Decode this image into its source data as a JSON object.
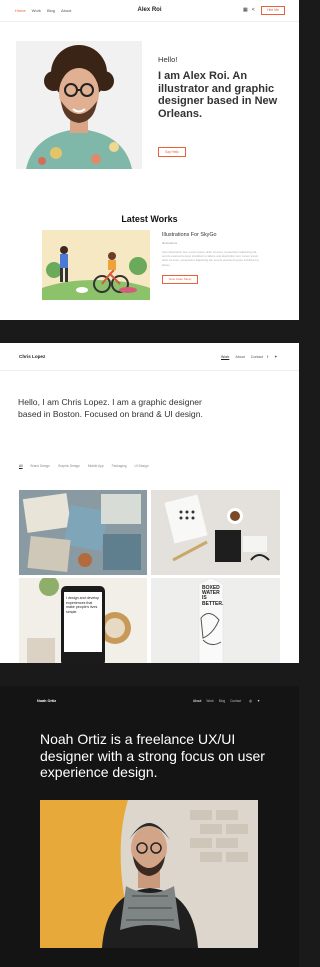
{
  "page1": {
    "nav": {
      "links": [
        "Home",
        "Work",
        "Blog",
        "About"
      ],
      "brand": "Alex Roi",
      "hire_label": "Hire Me"
    },
    "hero": {
      "greeting": "Hello!",
      "intro": "I am Alex Roi. An illustrator and graphic designer based in New Orleans.",
      "button_label": "Say Hello"
    },
    "works": {
      "section_title": "Latest Works",
      "item": {
        "title": "Illustrations For SkyGo",
        "category": "Illustrations",
        "description": "Vero description text. Lorem ipsum dolor sit amet, consectetur adipiscing elit, sed do eiusmod tempor incididunt ut labore and description text. Lorem ipsum dolor sit amet, consectetur adipiscing elit, sed do eiusmod tempor incididunt ut labore.",
        "button_label": "View Case Study"
      }
    }
  },
  "page2": {
    "nav": {
      "brand": "Chris Lopez",
      "menu": [
        "Work",
        "About",
        "Contact"
      ]
    },
    "intro": "Hello, I am Chris Lopez. I am a graphic designer based in Boston. Focused on brand & UI design.",
    "filters": [
      "All",
      "Brand Design",
      "Graphic Design",
      "Mobile App",
      "Packaging",
      "UI Design"
    ],
    "phone_text": "I design and develop experiences that make people's lives simple.",
    "carton_text": "BOXED WATER IS BETTER."
  },
  "page3": {
    "nav": {
      "brand": "Noah Ortiz",
      "menu": [
        "About",
        "Work",
        "Blog",
        "Contact"
      ]
    },
    "intro": "Noah Ortiz is a freelance UX/UI designer with a strong focus on user experience design."
  },
  "colors": {
    "accent": "#e8603c",
    "dark_bg": "#141414"
  }
}
